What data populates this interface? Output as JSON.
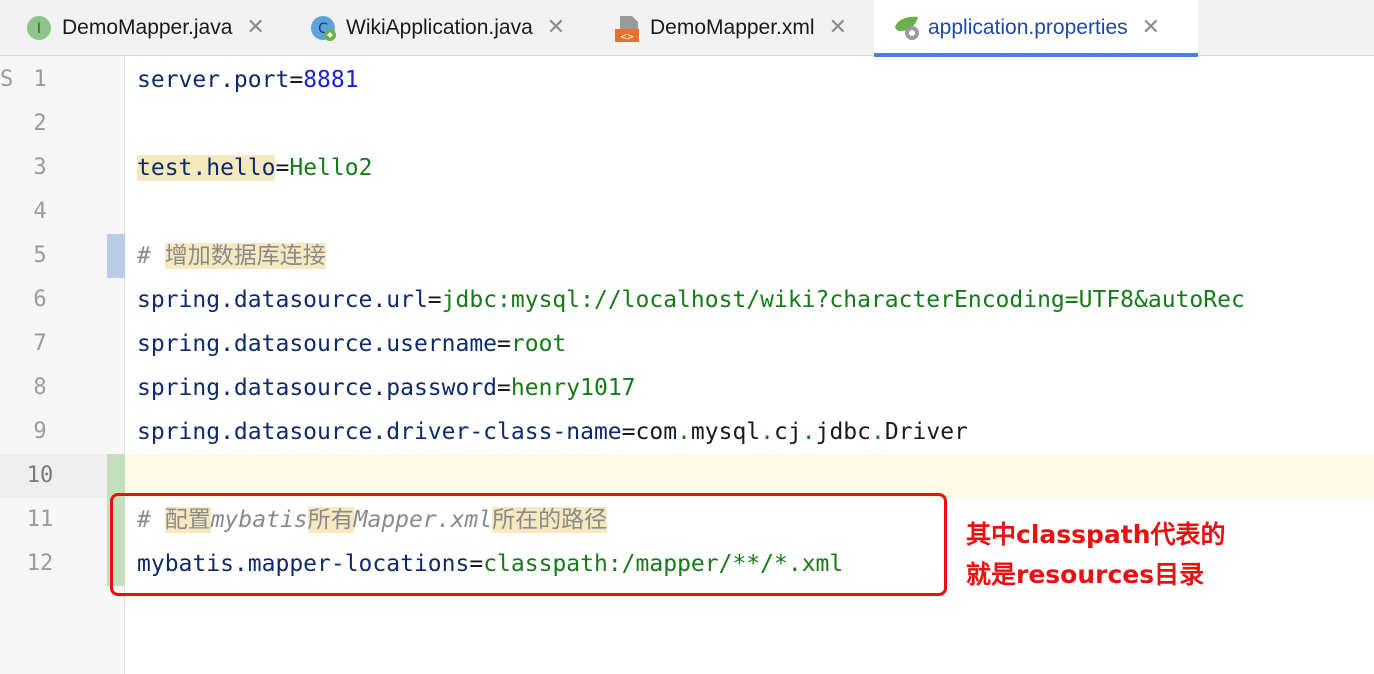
{
  "tabs": [
    {
      "label": "DemoMapper.java",
      "icon": "interface-icon",
      "close": "✕"
    },
    {
      "label": "WikiApplication.java",
      "icon": "class-icon",
      "close": "✕"
    },
    {
      "label": "DemoMapper.xml",
      "icon": "xml-file-icon",
      "close": "✕"
    },
    {
      "label": "application.properties",
      "icon": "spring-properties-icon",
      "close": "✕",
      "active": true
    }
  ],
  "gutter": {
    "cut_char": "S",
    "line_numbers": [
      "1",
      "2",
      "3",
      "4",
      "5",
      "6",
      "7",
      "8",
      "9",
      "10",
      "11",
      "12"
    ]
  },
  "code": {
    "l1": {
      "key": "server.port",
      "eq": "=",
      "val": "8881"
    },
    "l3": {
      "key": "test.hello",
      "eq": "=",
      "val": "Hello2"
    },
    "l5": {
      "hash": "# ",
      "text": "增加数据库连接"
    },
    "l6": {
      "key": "spring.datasource.url",
      "eq": "=",
      "val": "jdbc:mysql://localhost/wiki?characterEncoding=UTF8&autoRec"
    },
    "l7": {
      "key": "spring.datasource.username",
      "eq": "=",
      "val": "root"
    },
    "l8": {
      "key": "spring.datasource.password",
      "eq": "=",
      "val": "henry1017"
    },
    "l9": {
      "key": "spring.datasource.driver-class-name",
      "eq": "=",
      "v1": "com",
      "d1": ".",
      "v2": "mysql",
      "d2": ".",
      "v3": "cj",
      "d3": ".",
      "v4": "jdbc",
      "d4": ".",
      "v5": "Driver"
    },
    "l11": {
      "hash": "# ",
      "a": "配置",
      "b": "mybatis",
      "c": "所有",
      "d": "Mapper.xml",
      "e": "所在的路径"
    },
    "l12": {
      "key": "mybatis.mapper-locations",
      "eq": "=",
      "val": "classpath:/mapper/**/*.xml"
    }
  },
  "annotation": {
    "line1": "其中classpath代表的",
    "line2": "就是resources目录"
  },
  "colors": {
    "accent": "#4a83d8",
    "annotation_red": "#e81010",
    "key_blue": "#0d2b6b",
    "value_green": "#167a17",
    "number_blue": "#1a1fd1"
  }
}
